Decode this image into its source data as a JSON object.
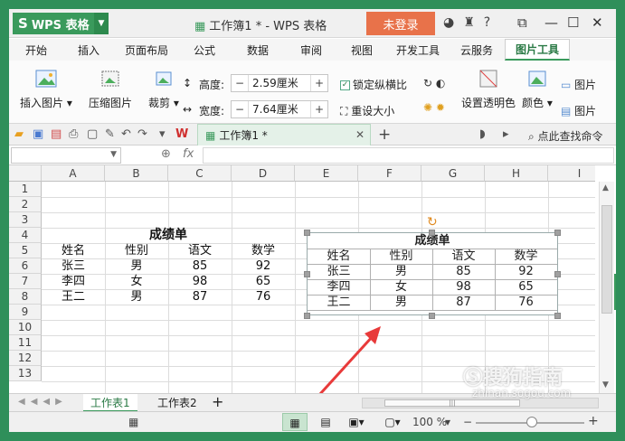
{
  "titlebar": {
    "app_name": "WPS 表格",
    "logo_glyph": "S",
    "document_title": "工作簿1 * - WPS 表格",
    "login_label": "未登录",
    "help_label": "?"
  },
  "menu": {
    "tabs": [
      "开始",
      "插入",
      "页面布局",
      "公式",
      "数据",
      "审阅",
      "视图",
      "开发工具",
      "云服务",
      "图片工具"
    ],
    "active_index": 9
  },
  "ribbon": {
    "insert_picture": "插入图片",
    "compress_picture": "压缩图片",
    "crop": "裁剪",
    "height_label": "高度:",
    "height_value": "2.59厘米",
    "width_label": "宽度:",
    "width_value": "7.64厘米",
    "lock_ratio": "锁定纵横比",
    "reset_size": "重设大小",
    "set_transparent": "设置透明色",
    "color": "颜色",
    "picture_1": "图片",
    "picture_2": "图片"
  },
  "docbar": {
    "doc_tab": "工作簿1 *",
    "search_cmd": "点此查找命令"
  },
  "formula": {
    "fx_label": "fx"
  },
  "grid": {
    "columns": [
      "A",
      "B",
      "C",
      "D",
      "E",
      "F",
      "G",
      "H",
      "I"
    ],
    "rows": [
      "1",
      "2",
      "3",
      "4",
      "5",
      "6",
      "7",
      "8",
      "9",
      "10",
      "11",
      "12",
      "13"
    ]
  },
  "table": {
    "title": "成绩单",
    "headers": [
      "姓名",
      "性别",
      "语文",
      "数学"
    ],
    "rows": [
      [
        "张三",
        "男",
        "85",
        "92"
      ],
      [
        "李四",
        "女",
        "98",
        "65"
      ],
      [
        "王二",
        "男",
        "87",
        "76"
      ]
    ]
  },
  "picture": {
    "title": "成绩单",
    "headers": [
      "姓名",
      "性别",
      "语文",
      "数学"
    ],
    "rows": [
      [
        "张三",
        "男",
        "85",
        "92"
      ],
      [
        "李四",
        "女",
        "98",
        "65"
      ],
      [
        "王二",
        "男",
        "87",
        "76"
      ]
    ]
  },
  "sheets": {
    "tabs": [
      "工作表1",
      "工作表2"
    ],
    "active_index": 0,
    "add_label": "+"
  },
  "status": {
    "zoom": "100 %",
    "minus": "−",
    "plus": "+"
  },
  "watermark": {
    "brand": "搜狗指南",
    "url": "zhinan.sogou.com"
  },
  "colors": {
    "accent": "#3a9a5c",
    "login": "#e8724a",
    "arrow": "#e83a3a"
  }
}
